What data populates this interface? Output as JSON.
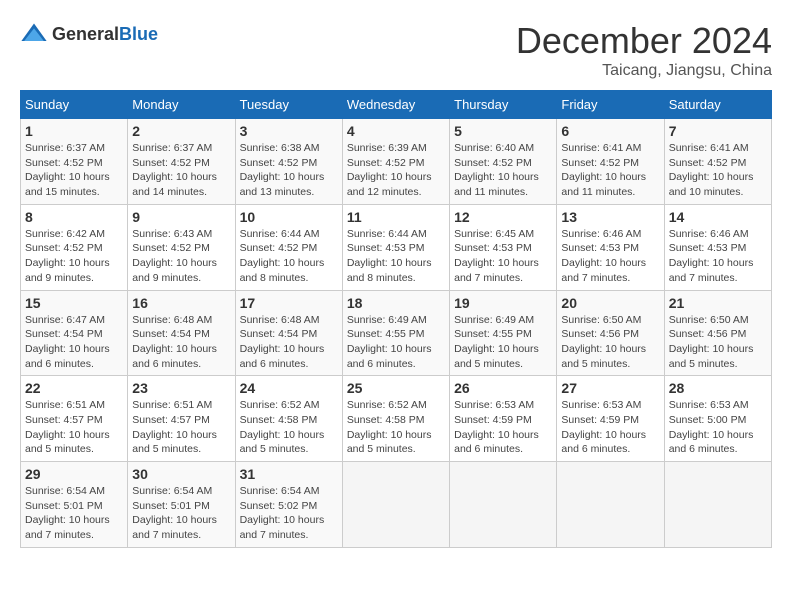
{
  "header": {
    "logo": {
      "general": "General",
      "blue": "Blue"
    },
    "title": "December 2024",
    "location": "Taicang, Jiangsu, China"
  },
  "weekdays": [
    "Sunday",
    "Monday",
    "Tuesday",
    "Wednesday",
    "Thursday",
    "Friday",
    "Saturday"
  ],
  "weeks": [
    [
      {
        "day": "1",
        "sunrise": "6:37 AM",
        "sunset": "4:52 PM",
        "daylight": "10 hours and 15 minutes."
      },
      {
        "day": "2",
        "sunrise": "6:37 AM",
        "sunset": "4:52 PM",
        "daylight": "10 hours and 14 minutes."
      },
      {
        "day": "3",
        "sunrise": "6:38 AM",
        "sunset": "4:52 PM",
        "daylight": "10 hours and 13 minutes."
      },
      {
        "day": "4",
        "sunrise": "6:39 AM",
        "sunset": "4:52 PM",
        "daylight": "10 hours and 12 minutes."
      },
      {
        "day": "5",
        "sunrise": "6:40 AM",
        "sunset": "4:52 PM",
        "daylight": "10 hours and 11 minutes."
      },
      {
        "day": "6",
        "sunrise": "6:41 AM",
        "sunset": "4:52 PM",
        "daylight": "10 hours and 11 minutes."
      },
      {
        "day": "7",
        "sunrise": "6:41 AM",
        "sunset": "4:52 PM",
        "daylight": "10 hours and 10 minutes."
      }
    ],
    [
      {
        "day": "8",
        "sunrise": "6:42 AM",
        "sunset": "4:52 PM",
        "daylight": "10 hours and 9 minutes."
      },
      {
        "day": "9",
        "sunrise": "6:43 AM",
        "sunset": "4:52 PM",
        "daylight": "10 hours and 9 minutes."
      },
      {
        "day": "10",
        "sunrise": "6:44 AM",
        "sunset": "4:52 PM",
        "daylight": "10 hours and 8 minutes."
      },
      {
        "day": "11",
        "sunrise": "6:44 AM",
        "sunset": "4:53 PM",
        "daylight": "10 hours and 8 minutes."
      },
      {
        "day": "12",
        "sunrise": "6:45 AM",
        "sunset": "4:53 PM",
        "daylight": "10 hours and 7 minutes."
      },
      {
        "day": "13",
        "sunrise": "6:46 AM",
        "sunset": "4:53 PM",
        "daylight": "10 hours and 7 minutes."
      },
      {
        "day": "14",
        "sunrise": "6:46 AM",
        "sunset": "4:53 PM",
        "daylight": "10 hours and 7 minutes."
      }
    ],
    [
      {
        "day": "15",
        "sunrise": "6:47 AM",
        "sunset": "4:54 PM",
        "daylight": "10 hours and 6 minutes."
      },
      {
        "day": "16",
        "sunrise": "6:48 AM",
        "sunset": "4:54 PM",
        "daylight": "10 hours and 6 minutes."
      },
      {
        "day": "17",
        "sunrise": "6:48 AM",
        "sunset": "4:54 PM",
        "daylight": "10 hours and 6 minutes."
      },
      {
        "day": "18",
        "sunrise": "6:49 AM",
        "sunset": "4:55 PM",
        "daylight": "10 hours and 6 minutes."
      },
      {
        "day": "19",
        "sunrise": "6:49 AM",
        "sunset": "4:55 PM",
        "daylight": "10 hours and 5 minutes."
      },
      {
        "day": "20",
        "sunrise": "6:50 AM",
        "sunset": "4:56 PM",
        "daylight": "10 hours and 5 minutes."
      },
      {
        "day": "21",
        "sunrise": "6:50 AM",
        "sunset": "4:56 PM",
        "daylight": "10 hours and 5 minutes."
      }
    ],
    [
      {
        "day": "22",
        "sunrise": "6:51 AM",
        "sunset": "4:57 PM",
        "daylight": "10 hours and 5 minutes."
      },
      {
        "day": "23",
        "sunrise": "6:51 AM",
        "sunset": "4:57 PM",
        "daylight": "10 hours and 5 minutes."
      },
      {
        "day": "24",
        "sunrise": "6:52 AM",
        "sunset": "4:58 PM",
        "daylight": "10 hours and 5 minutes."
      },
      {
        "day": "25",
        "sunrise": "6:52 AM",
        "sunset": "4:58 PM",
        "daylight": "10 hours and 5 minutes."
      },
      {
        "day": "26",
        "sunrise": "6:53 AM",
        "sunset": "4:59 PM",
        "daylight": "10 hours and 6 minutes."
      },
      {
        "day": "27",
        "sunrise": "6:53 AM",
        "sunset": "4:59 PM",
        "daylight": "10 hours and 6 minutes."
      },
      {
        "day": "28",
        "sunrise": "6:53 AM",
        "sunset": "5:00 PM",
        "daylight": "10 hours and 6 minutes."
      }
    ],
    [
      {
        "day": "29",
        "sunrise": "6:54 AM",
        "sunset": "5:01 PM",
        "daylight": "10 hours and 7 minutes."
      },
      {
        "day": "30",
        "sunrise": "6:54 AM",
        "sunset": "5:01 PM",
        "daylight": "10 hours and 7 minutes."
      },
      {
        "day": "31",
        "sunrise": "6:54 AM",
        "sunset": "5:02 PM",
        "daylight": "10 hours and 7 minutes."
      },
      null,
      null,
      null,
      null
    ]
  ]
}
